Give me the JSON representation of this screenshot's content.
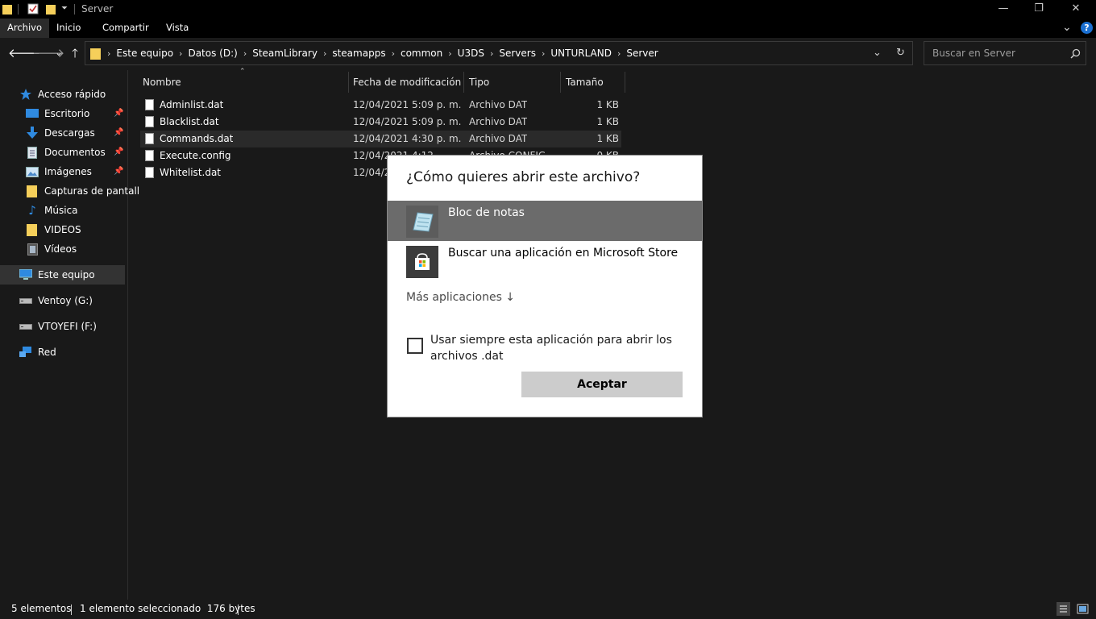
{
  "window": {
    "title": "Server",
    "controls": {
      "minimize": "—",
      "maximize": "❐",
      "close": "✕"
    }
  },
  "ribbon": {
    "tabs": [
      {
        "label": "Archivo",
        "active": true
      },
      {
        "label": "Inicio"
      },
      {
        "label": "Compartir"
      },
      {
        "label": "Vista"
      }
    ],
    "help": "?"
  },
  "address": {
    "path": [
      "Este equipo",
      "Datos (D:)",
      "SteamLibrary",
      "steamapps",
      "common",
      "U3DS",
      "Servers",
      "UNTURLAND",
      "Server"
    ]
  },
  "search": {
    "placeholder": "Buscar en Server"
  },
  "sidebar": {
    "items": [
      {
        "label": "Acceso rápido",
        "icon": "star-icon"
      },
      {
        "label": "Escritorio",
        "icon": "desktop-icon",
        "pinned": true
      },
      {
        "label": "Descargas",
        "icon": "download-icon",
        "pinned": true
      },
      {
        "label": "Documentos",
        "icon": "documents-icon",
        "pinned": true
      },
      {
        "label": "Imágenes",
        "icon": "pictures-icon",
        "pinned": true
      },
      {
        "label": "Capturas de pantall",
        "icon": "folder-icon"
      },
      {
        "label": "Música",
        "icon": "music-icon"
      },
      {
        "label": "VIDEOS",
        "icon": "folder-icon"
      },
      {
        "label": "Vídeos",
        "icon": "videos-icon"
      },
      {
        "label": "Este equipo",
        "icon": "computer-icon",
        "selected": true
      },
      {
        "label": "Ventoy (G:)",
        "icon": "drive-icon"
      },
      {
        "label": "VTOYEFI (F:)",
        "icon": "drive-icon"
      },
      {
        "label": "Red",
        "icon": "network-icon"
      }
    ]
  },
  "columns": {
    "name": "Nombre",
    "date": "Fecha de modificación",
    "type": "Tipo",
    "size": "Tamaño"
  },
  "files": [
    {
      "name": "Adminlist.dat",
      "date": "12/04/2021 5:09 p. m.",
      "type": "Archivo DAT",
      "size": "1 KB"
    },
    {
      "name": "Blacklist.dat",
      "date": "12/04/2021 5:09 p. m.",
      "type": "Archivo DAT",
      "size": "1 KB"
    },
    {
      "name": "Commands.dat",
      "date": "12/04/2021 4:30 p. m.",
      "type": "Archivo DAT",
      "size": "1 KB",
      "selected": true
    },
    {
      "name": "Execute.config",
      "date": "12/04/2021 4:12 ...",
      "type": "Archivo CONFIG",
      "size": "0 KB"
    },
    {
      "name": "Whitelist.dat",
      "date": "12/04/20",
      "type": "",
      "size": ""
    }
  ],
  "status": {
    "count": "5 elementos",
    "selection": "1 elemento seleccionado  176 bytes"
  },
  "dialog": {
    "title": "¿Cómo quieres abrir este archivo?",
    "apps": [
      {
        "label": "Bloc de notas",
        "icon": "notepad-icon",
        "selected": true
      },
      {
        "label": "Buscar una aplicación en Microsoft Store",
        "icon": "store-icon"
      }
    ],
    "more_apps": "Más aplicaciones ↓",
    "always_use": "Usar siempre esta aplicación para abrir los archivos .dat",
    "always_use_checked": false,
    "ok": "Aceptar"
  },
  "colors": {
    "background": "#191919",
    "titlebar": "#000000",
    "selection": "#333333",
    "dialog_selected": "#6b6b6b",
    "folder": "#f5cf5a",
    "accent_blue": "#1a6fd0"
  }
}
